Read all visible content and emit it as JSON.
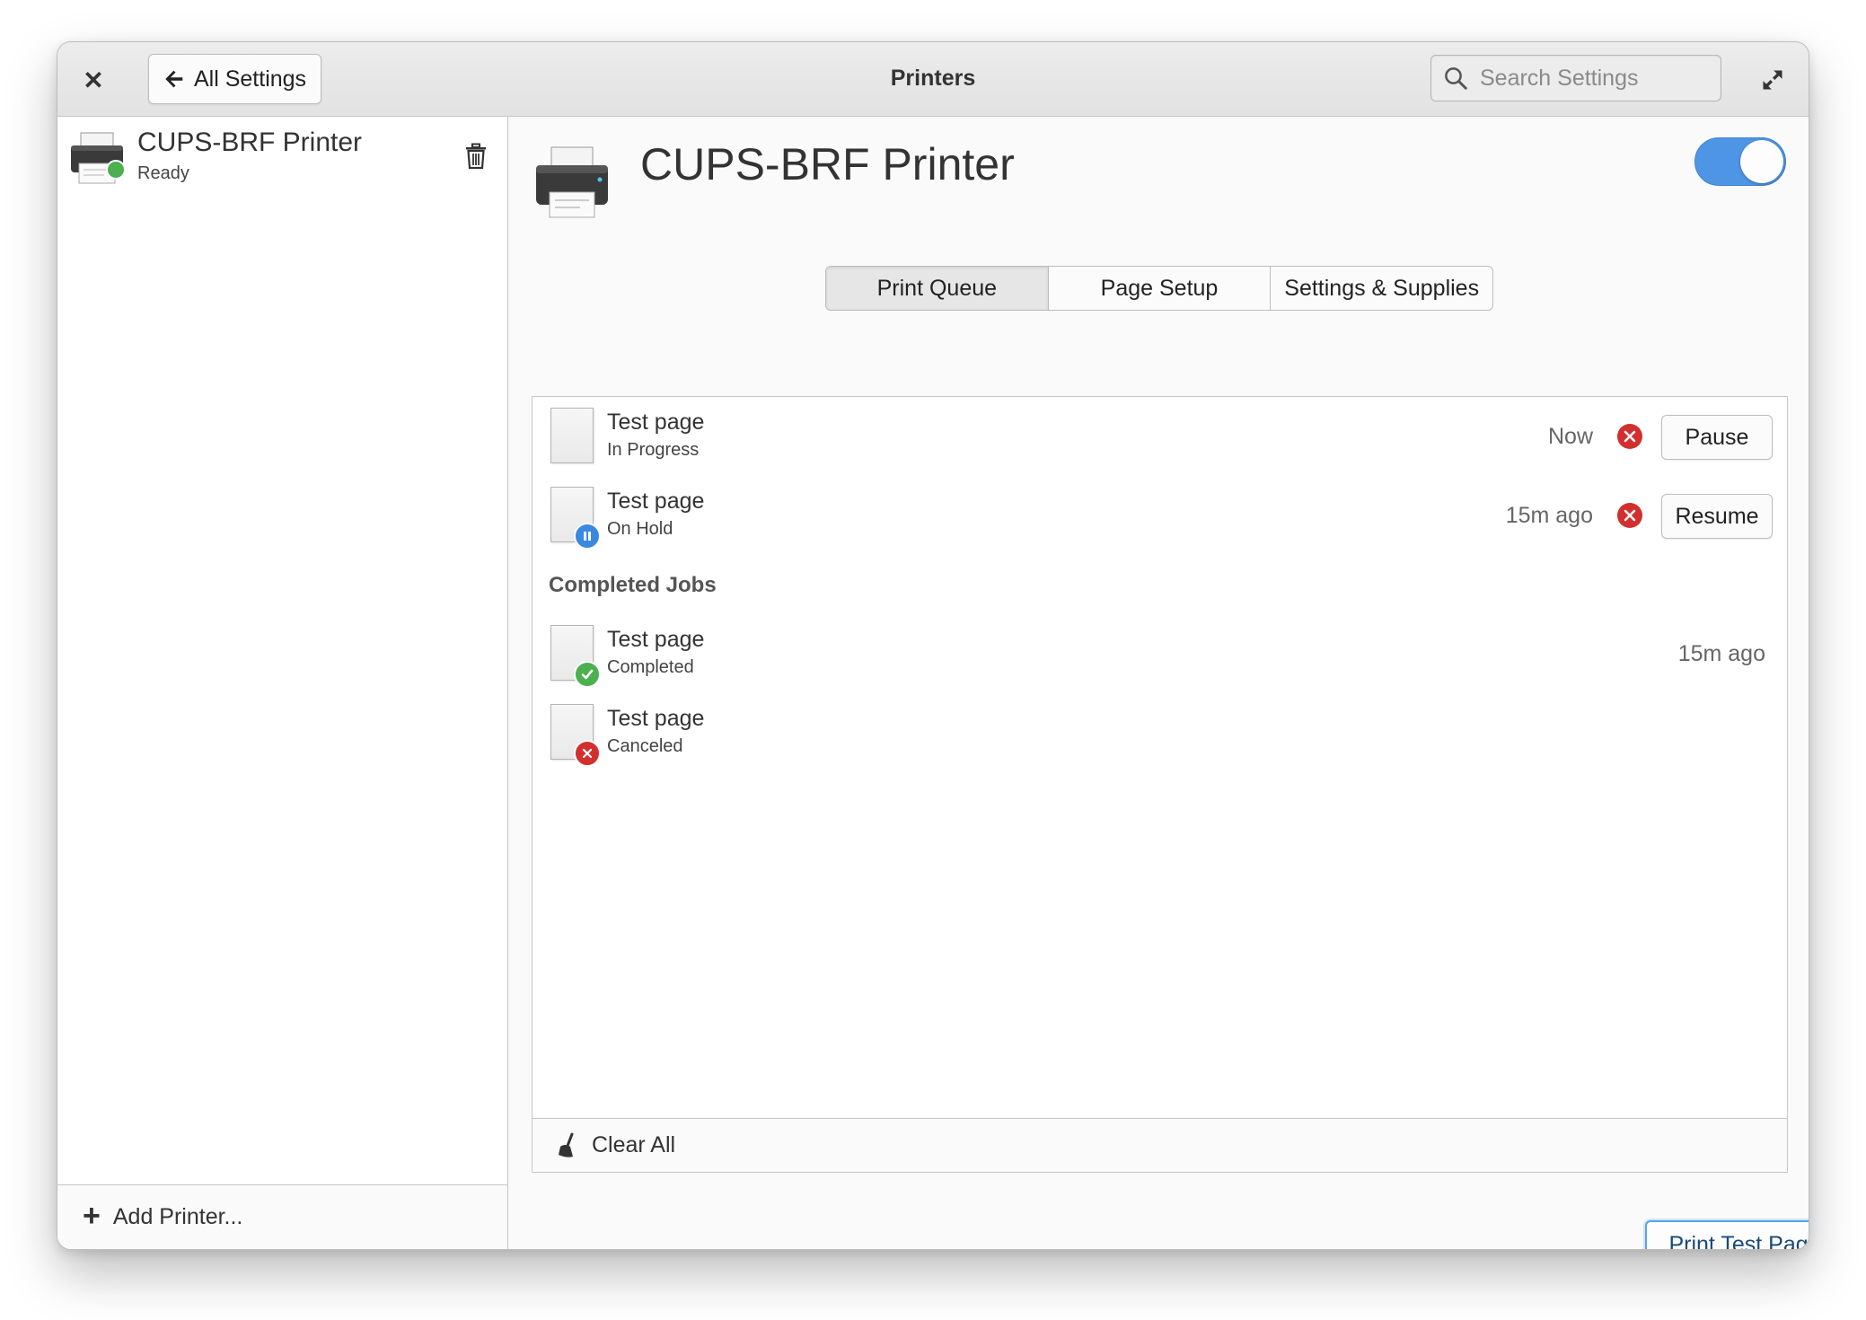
{
  "window": {
    "title": "Printers",
    "back_label": "All Settings",
    "search_placeholder": "Search Settings"
  },
  "sidebar": {
    "printers": [
      {
        "name": "CUPS-BRF Printer",
        "status": "Ready"
      }
    ],
    "add_label": "Add Printer..."
  },
  "detail": {
    "printer_name": "CUPS-BRF Printer",
    "enabled": true,
    "tabs": [
      {
        "label": "Print Queue",
        "active": true
      },
      {
        "label": "Page Setup",
        "active": false
      },
      {
        "label": "Settings & Supplies",
        "active": false
      }
    ],
    "active_jobs": [
      {
        "title": "Test page",
        "status": "In Progress",
        "time": "Now",
        "action": "Pause",
        "badge": "none"
      },
      {
        "title": "Test page",
        "status": "On Hold",
        "time": "15m ago",
        "action": "Resume",
        "badge": "pause-badge-icon"
      }
    ],
    "completed_heading": "Completed Jobs",
    "completed_jobs": [
      {
        "title": "Test page",
        "status": "Completed",
        "time": "15m ago",
        "badge": "check-badge-icon"
      },
      {
        "title": "Test page",
        "status": "Canceled",
        "time": "",
        "badge": "cancel-badge-icon"
      }
    ],
    "clear_all_label": "Clear All",
    "print_test_label": "Print Test Page"
  },
  "colors": {
    "accent": "#4f95e6",
    "ready_green": "#4caf50",
    "error_red": "#d32f2f",
    "hold_blue": "#3a89e0"
  }
}
